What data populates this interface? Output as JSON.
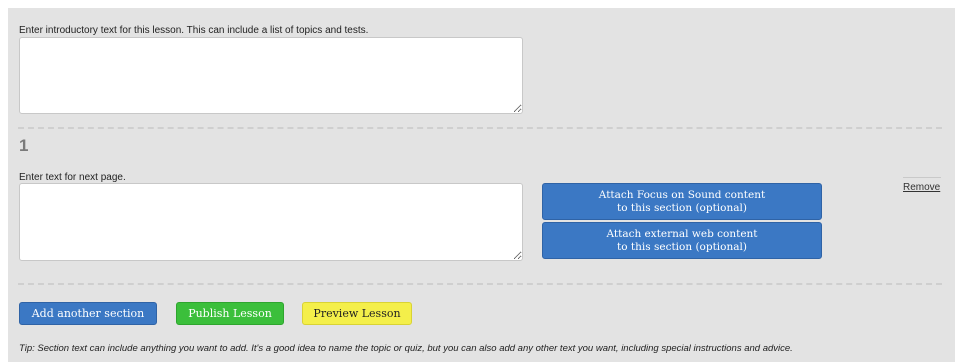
{
  "intro": {
    "label": "Enter introductory text for this lesson. This can include a list of topics and tests.",
    "value": ""
  },
  "section": {
    "number": "1",
    "label": "Enter text for next page.",
    "value": "",
    "attach_sound_line1": "Attach Focus on Sound content",
    "attach_sound_line2": "to this section (optional)",
    "attach_web_line1": "Attach external web content",
    "attach_web_line2": "to this section (optional)",
    "remove_label": "Remove"
  },
  "actions": {
    "add_label": "Add another section",
    "publish_label": "Publish Lesson",
    "preview_label": "Preview Lesson"
  },
  "tip": "Tip: Section text can include anything you want to add. It's a good idea to name the topic or quiz, but you can also add any other text you want, including special instructions and advice.",
  "colors": {
    "panel_bg": "#e3e3e3",
    "blue": "#3b78c4",
    "green": "#3bbf3b",
    "yellow": "#f4ef4a"
  }
}
